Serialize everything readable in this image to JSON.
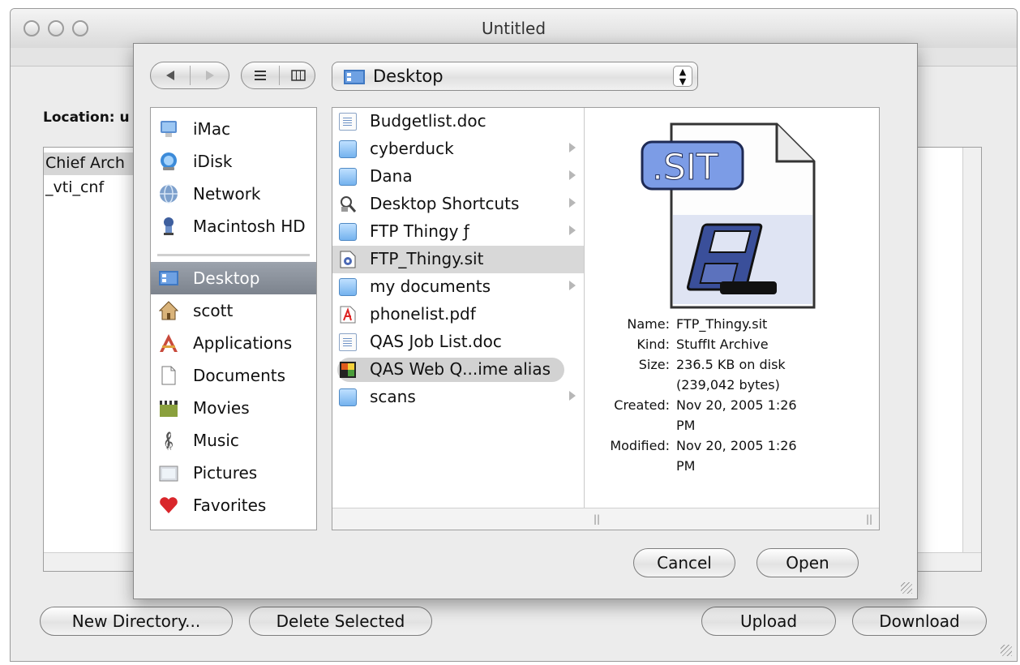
{
  "window": {
    "title": "Untitled"
  },
  "main": {
    "location_label": "Location: u",
    "list_items": [
      "Chief Arch",
      "_vti_cnf"
    ],
    "buttons": {
      "new_directory": "New Directory...",
      "delete_selected": "Delete Selected",
      "upload": "Upload",
      "download": "Download"
    }
  },
  "sheet": {
    "location_popup": "Desktop",
    "sidebar": [
      {
        "label": "iMac",
        "icon": "imac-icon"
      },
      {
        "label": "iDisk",
        "icon": "idisk-icon"
      },
      {
        "label": "Network",
        "icon": "network-icon"
      },
      {
        "label": "Macintosh HD",
        "icon": "hard-drive-icon"
      },
      {
        "label": "Desktop",
        "icon": "desktop-icon",
        "selected": true
      },
      {
        "label": "scott",
        "icon": "home-icon"
      },
      {
        "label": "Applications",
        "icon": "applications-icon"
      },
      {
        "label": "Documents",
        "icon": "documents-icon"
      },
      {
        "label": "Movies",
        "icon": "movies-icon"
      },
      {
        "label": "Music",
        "icon": "music-icon"
      },
      {
        "label": "Pictures",
        "icon": "pictures-icon"
      },
      {
        "label": "Favorites",
        "icon": "favorites-icon"
      }
    ],
    "files": [
      {
        "label": "Budgetlist.doc",
        "icon": "document-icon",
        "folder": false
      },
      {
        "label": "cyberduck",
        "icon": "folder-icon",
        "folder": true
      },
      {
        "label": "Dana",
        "icon": "folder-icon",
        "folder": true
      },
      {
        "label": "Desktop Shortcuts",
        "icon": "shortcuts-icon",
        "folder": true
      },
      {
        "label": "FTP Thingy ƒ",
        "icon": "folder-icon",
        "folder": true
      },
      {
        "label": "FTP_Thingy.sit",
        "icon": "stuffit-icon",
        "folder": false,
        "selected": true
      },
      {
        "label": "my documents",
        "icon": "folder-icon",
        "folder": true
      },
      {
        "label": "phonelist.pdf",
        "icon": "pdf-icon",
        "folder": false
      },
      {
        "label": "QAS Job List.doc",
        "icon": "document-icon",
        "folder": false
      },
      {
        "label": "QAS Web Q...ime alias",
        "icon": "alias-icon",
        "folder": false,
        "alias": true
      },
      {
        "label": "scans",
        "icon": "folder-icon",
        "folder": true
      }
    ],
    "preview": {
      "badge": ".SIT",
      "info": [
        {
          "key": "Name:",
          "value": "FTP_Thingy.sit"
        },
        {
          "key": "Kind:",
          "value": "StuffIt Archive"
        },
        {
          "key": "Size:",
          "value": "236.5 KB on disk"
        },
        {
          "key": "",
          "value": "(239,042 bytes)"
        },
        {
          "key": "Created:",
          "value": "Nov 20, 2005 1:26"
        },
        {
          "key": "",
          "value": "PM"
        },
        {
          "key": "Modified:",
          "value": "Nov 20, 2005 1:26"
        },
        {
          "key": "",
          "value": "PM"
        }
      ]
    },
    "buttons": {
      "cancel": "Cancel",
      "open": "Open"
    }
  },
  "colors": {
    "selection": "#7c838d",
    "folder": "#74b2ee",
    "accent": "#4f89c4"
  }
}
